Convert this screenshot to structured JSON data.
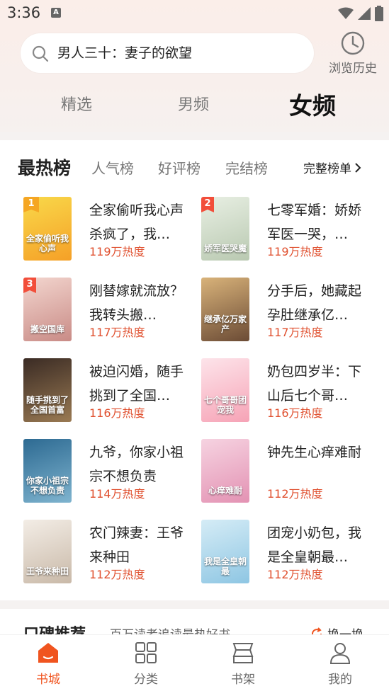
{
  "status_bar": {
    "time": "3:36",
    "notification": "A"
  },
  "search": {
    "query": "男人三十：妻子的欲望",
    "history_label": "浏览历史"
  },
  "top_tabs": [
    {
      "label": "精选",
      "active": false
    },
    {
      "label": "男频",
      "active": false
    },
    {
      "label": "女频",
      "active": true
    }
  ],
  "ranking": {
    "title": "最热榜",
    "tabs": [
      "人气榜",
      "好评榜",
      "完结榜"
    ],
    "full_list": "完整榜单",
    "books": [
      {
        "rank": "1",
        "title": "全家偷听我心声杀疯了，我…",
        "heat": "119万热度",
        "cover_text": "全家偷听我心声",
        "cover_colors": [
          "#f9d94a",
          "#f5a027"
        ]
      },
      {
        "rank": "2",
        "title": "七零军婚：娇娇军医一哭，…",
        "heat": "119万热度",
        "cover_text": "娇军医哭魔",
        "cover_colors": [
          "#e8efe3",
          "#b9c9b1"
        ]
      },
      {
        "rank": "3",
        "title": "刚替嫁就流放？我转头搬…",
        "heat": "117万热度",
        "cover_text": "搬空国库",
        "cover_colors": [
          "#f3d6cf",
          "#c98b86"
        ]
      },
      {
        "rank": "",
        "title": "分手后，她藏起孕肚继承亿…",
        "heat": "117万热度",
        "cover_text": "继承亿万家产",
        "cover_colors": [
          "#d9b37a",
          "#6b4b35"
        ]
      },
      {
        "rank": "",
        "title": "被迫闪婚，随手挑到了全国…",
        "heat": "116万热度",
        "cover_text": "随手挑到了全国首富",
        "cover_colors": [
          "#3a2b24",
          "#9a7a53"
        ]
      },
      {
        "rank": "",
        "title": "奶包四岁半：下山后七个哥…",
        "heat": "116万热度",
        "cover_text": "七个哥哥团宠我",
        "cover_colors": [
          "#fde4ea",
          "#f6a3b6"
        ]
      },
      {
        "rank": "",
        "title": "九爷，你家小祖宗不想负责",
        "heat": "114万热度",
        "cover_text": "你家小祖宗不想负责",
        "cover_colors": [
          "#2d6a92",
          "#7fb4cf"
        ]
      },
      {
        "rank": "",
        "title": "钟先生心痒难耐",
        "heat": "112万热度",
        "cover_text": "心痒难耐",
        "cover_colors": [
          "#f6d3e1",
          "#e392b3"
        ]
      },
      {
        "rank": "",
        "title": "农门辣妻：王爷来种田",
        "heat": "112万热度",
        "cover_text": "王爷来种田",
        "cover_colors": [
          "#f3ede6",
          "#c9b9a8"
        ]
      },
      {
        "rank": "",
        "title": "团宠小奶包，我是全皇朝最…",
        "heat": "112万热度",
        "cover_text": "我是全皇朝最",
        "cover_colors": [
          "#d5ecf6",
          "#8ec6e3"
        ]
      }
    ]
  },
  "recommend": {
    "title": "口碑推荐",
    "subtitle": "百万读者追读最热好书",
    "refresh": "换一换"
  },
  "bottom_nav": [
    {
      "label": "书城",
      "active": true
    },
    {
      "label": "分类",
      "active": false
    },
    {
      "label": "书架",
      "active": false
    },
    {
      "label": "我的",
      "active": false
    }
  ],
  "colors": {
    "accent": "#f0541f",
    "heat": "#e0502f"
  }
}
